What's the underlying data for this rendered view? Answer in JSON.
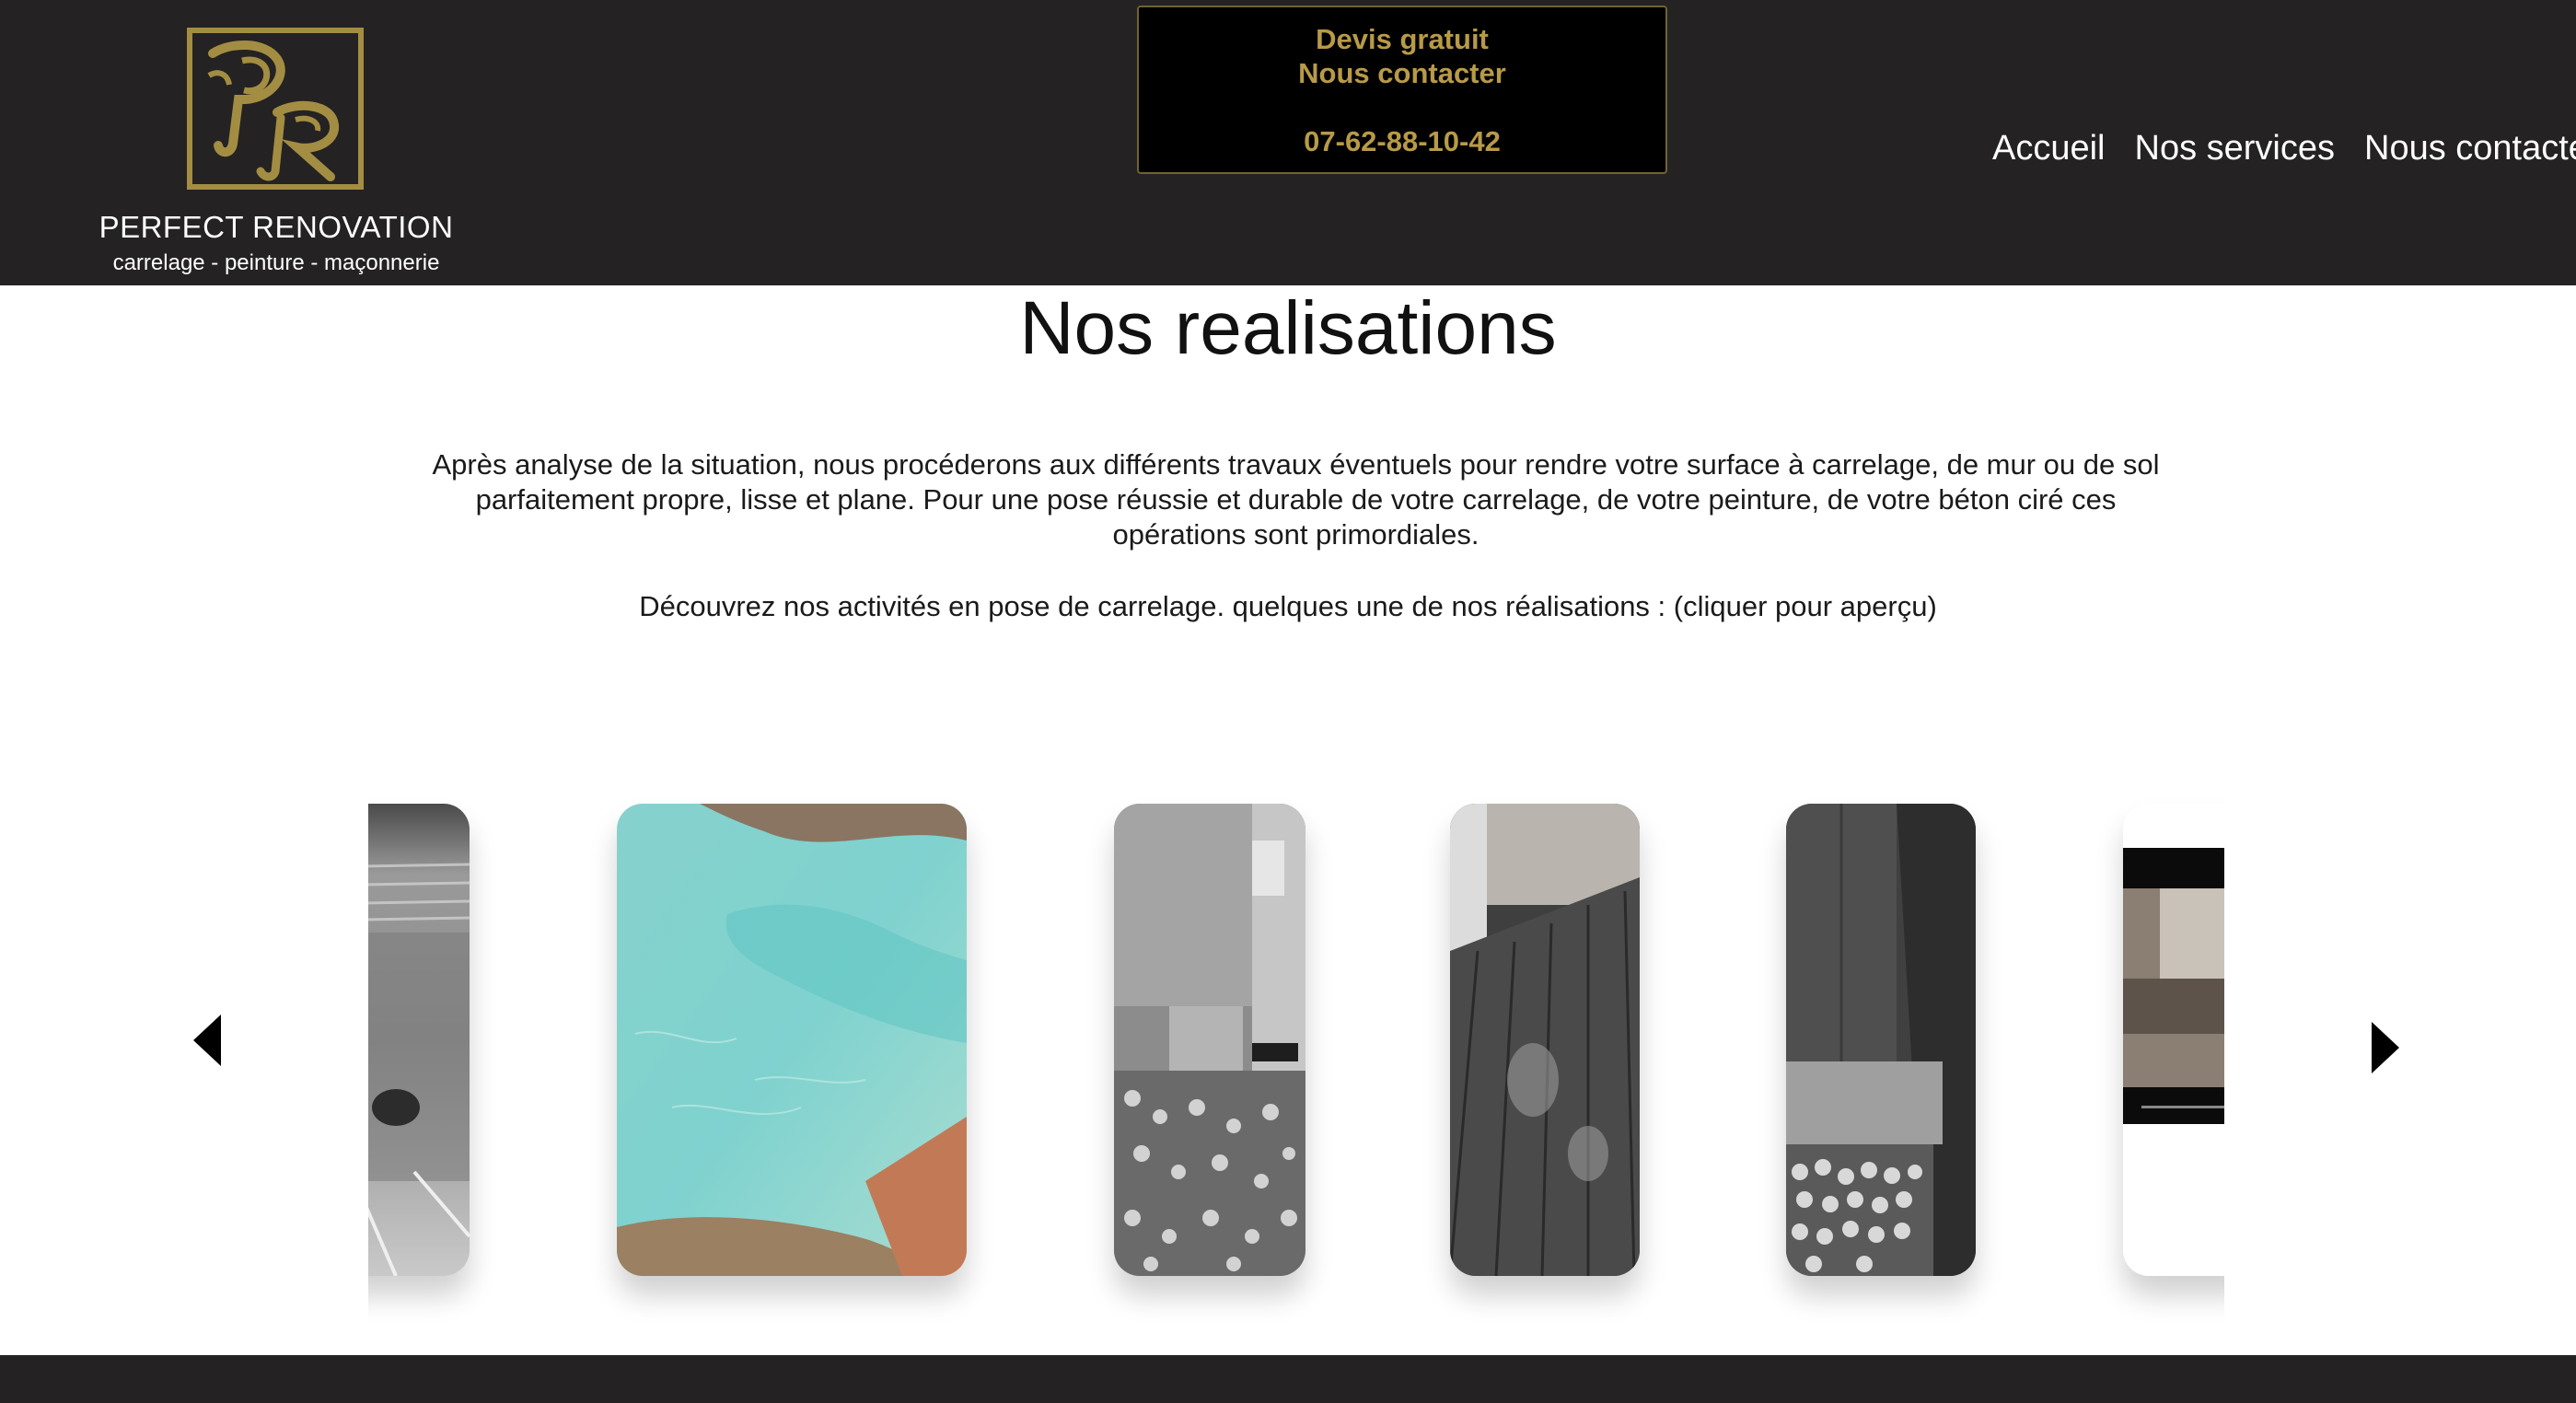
{
  "header": {
    "brand": {
      "name": "PERFECT RENOVATION",
      "tagline": "carrelage - peinture - maçonnerie",
      "logo_letters": "PR",
      "logo_color": "#a38d42"
    },
    "contact": {
      "line1": "Devis gratuit",
      "line2": "Nous contacter",
      "phone": "07-62-88-10-42",
      "accent_color": "#b89a47"
    },
    "nav": [
      {
        "label": "Accueil"
      },
      {
        "label": "Nos services"
      },
      {
        "label": "Nous contacter"
      }
    ]
  },
  "main": {
    "title": "Nos realisations",
    "intro": "Après analyse de la situation, nous procéderons aux différents travaux éventuels pour rendre votre surface à carrelage, de mur ou de sol parfaitement propre, lisse et plane. Pour une pose réussie et durable de votre carrelage, de votre peinture, de votre béton ciré ces opérations sont primordiales.",
    "intro_2": "Découvrez nos activités en pose de carrelage. quelques une de nos réalisations : (cliquer pour aperçu)"
  },
  "carousel": {
    "prev_icon": "triangle-left-icon",
    "next_icon": "triangle-right-icon",
    "slides": [
      {
        "subject": "stone-paving-bw"
      },
      {
        "subject": "pool-turquoise-water"
      },
      {
        "subject": "shower-pebble-floor-bw"
      },
      {
        "subject": "wood-effect-tile-floor-bw"
      },
      {
        "subject": "shower-niche-pebbles-bw"
      },
      {
        "subject": "video-renovation",
        "play_icon": "play-icon"
      }
    ]
  },
  "colors": {
    "header_bg": "#242223",
    "gold": "#a38d42",
    "footer_bg": "#242223"
  }
}
